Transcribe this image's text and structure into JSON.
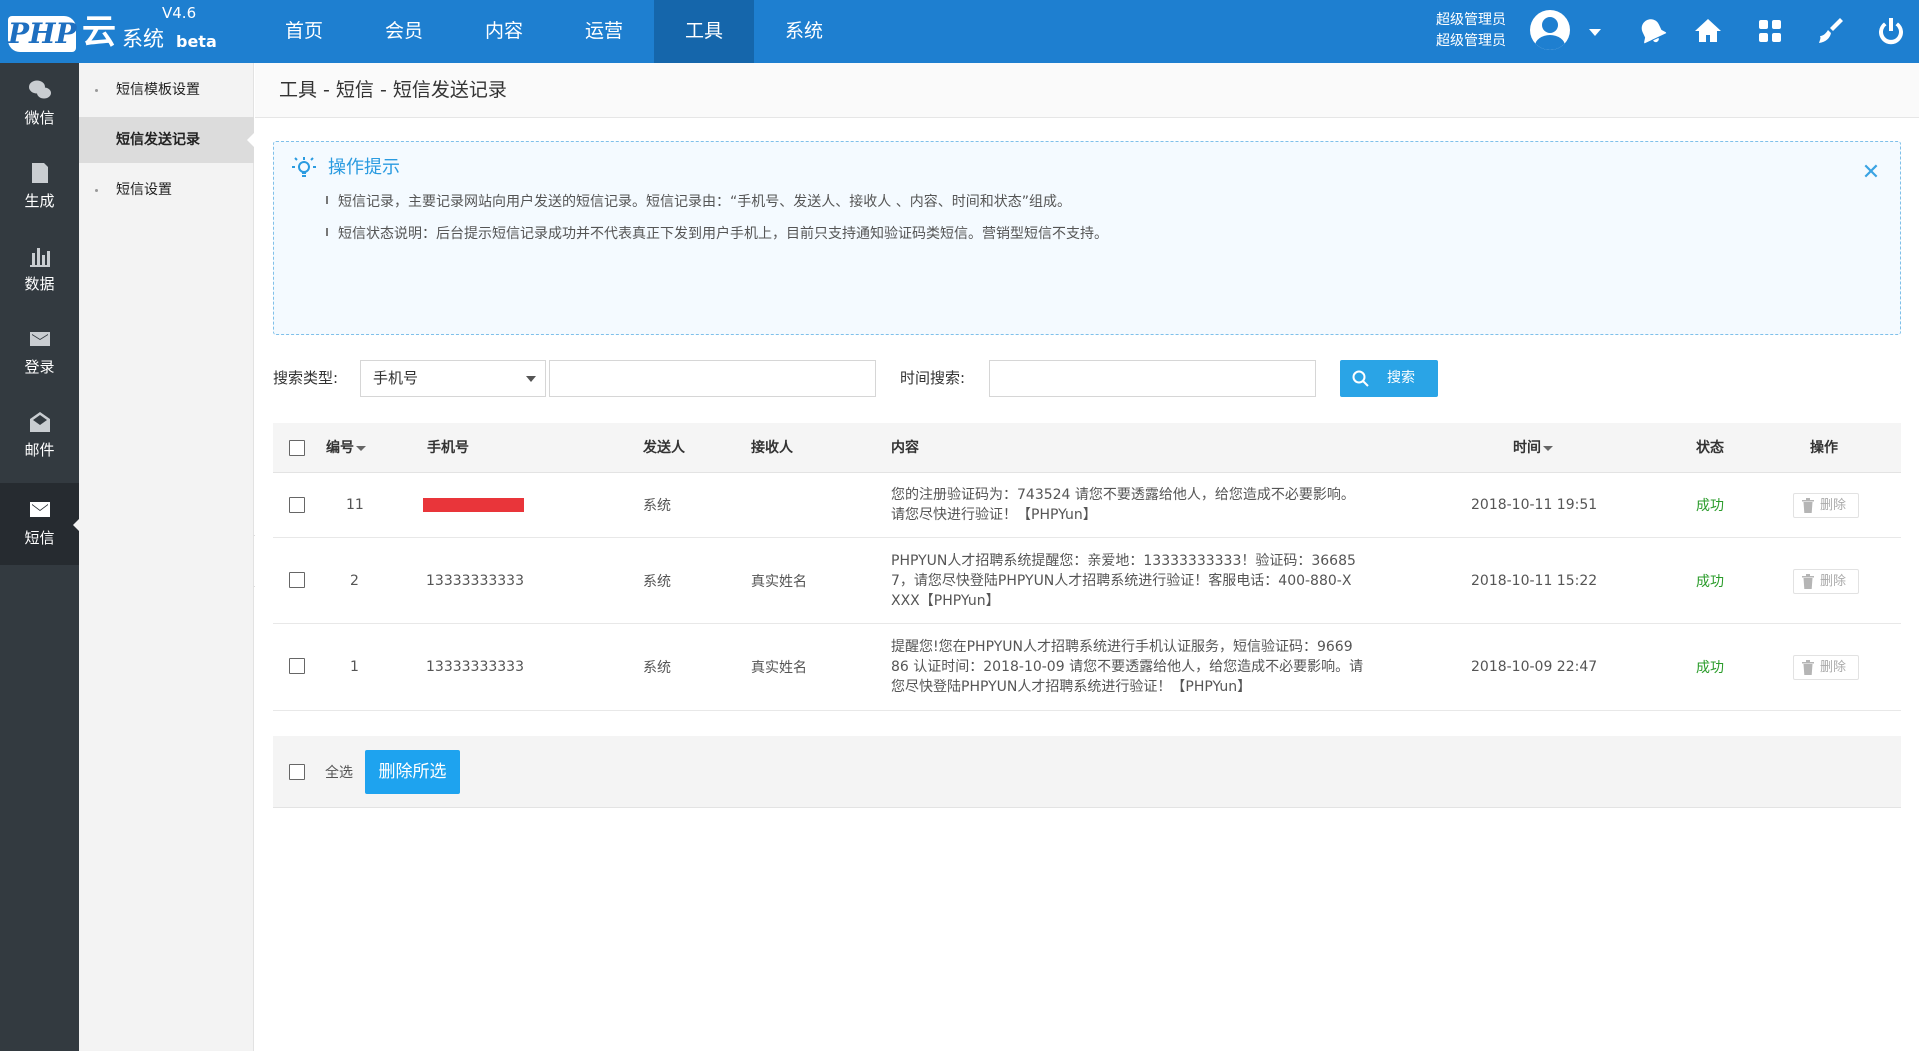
{
  "app": {
    "logo_mark": "PHP",
    "logo_cloud": "云",
    "logo_system": "系统",
    "logo_beta": "beta",
    "version": "V4.6"
  },
  "topnav": [
    {
      "label": "首页",
      "active": false
    },
    {
      "label": "会员",
      "active": false
    },
    {
      "label": "内容",
      "active": false
    },
    {
      "label": "运营",
      "active": false
    },
    {
      "label": "工具",
      "active": true
    },
    {
      "label": "系统",
      "active": false
    }
  ],
  "user": {
    "line1": "超级管理员",
    "line2": "超级管理员"
  },
  "top_icons": [
    "notification-bell-icon",
    "home-icon",
    "apps-grid-icon",
    "clear-cache-brush-icon",
    "power-icon"
  ],
  "iconbar": [
    {
      "label": "微信",
      "icon": "wechat-icon",
      "active": false
    },
    {
      "label": "生成",
      "icon": "generate-icon",
      "active": false
    },
    {
      "label": "数据",
      "icon": "bar-chart-icon",
      "active": false
    },
    {
      "label": "登录",
      "icon": "login-envelope-icon",
      "active": false
    },
    {
      "label": "邮件",
      "icon": "mail-icon",
      "active": false
    },
    {
      "label": "短信",
      "icon": "sms-icon",
      "active": true
    }
  ],
  "submenu": [
    {
      "label": "短信模板设置",
      "active": false
    },
    {
      "label": "短信发送记录",
      "active": true
    },
    {
      "label": "短信设置",
      "active": false
    }
  ],
  "breadcrumb": "工具 - 短信 - 短信发送记录",
  "tips": {
    "title": "操作提示",
    "lines": [
      "短信记录，主要记录网站向用户发送的短信记录。短信记录由：“手机号、发送人、接收人 、内容、时间和状态”组成。",
      "短信状态说明：后台提示短信记录成功并不代表真正下发到用户手机上，目前只支持通知验证码类短信。营销型短信不支持。"
    ]
  },
  "search": {
    "type_label": "搜索类型:",
    "type_value": "手机号",
    "keyword_value": "",
    "time_label": "时间搜索:",
    "time_value": "",
    "button": "搜索"
  },
  "table": {
    "headers": {
      "id": "编号",
      "phone": "手机号",
      "sender": "发送人",
      "receiver": "接收人",
      "content": "内容",
      "time": "时间",
      "status": "状态",
      "action": "操作"
    },
    "rows": [
      {
        "id": "11",
        "phone": "",
        "phone_redacted": true,
        "sender": "系统",
        "receiver": "",
        "content": [
          "您的注册验证码为：743524 请您不要透露给他人，给您造成不必要影响。",
          "请您尽快进行验证！【PHPYun】"
        ],
        "time": "2018-10-11 19:51",
        "status": "成功",
        "action": "删除"
      },
      {
        "id": "2",
        "phone": "13333333333",
        "phone_redacted": false,
        "sender": "系统",
        "receiver": "真实姓名",
        "content": [
          "PHPYUN人才招聘系统提醒您：亲爱地：13333333333！验证码：36685",
          "7，请您尽快登陆PHPYUN人才招聘系统进行验证！客服电话：400-880-X",
          "XXX【PHPYun】"
        ],
        "time": "2018-10-11 15:22",
        "status": "成功",
        "action": "删除"
      },
      {
        "id": "1",
        "phone": "13333333333",
        "phone_redacted": false,
        "sender": "系统",
        "receiver": "真实姓名",
        "content": [
          "提醒您!您在PHPYUN人才招聘系统进行手机认证服务，短信验证码：9669",
          "86 认证时间：2018-10-09 请您不要透露给他人，给您造成不必要影响。请",
          "您尽快登陆PHPYUN人才招聘系统进行验证！【PHPYun】"
        ],
        "time": "2018-10-09 22:47",
        "status": "成功",
        "action": "删除"
      }
    ],
    "footer": {
      "select_all": "全选",
      "delete_selected": "删除所选"
    }
  },
  "colors": {
    "topbar": "#1e7fd0",
    "topnav_active": "#1566ab",
    "sidebar": "#333a40",
    "accent": "#2aa4e6",
    "success": "#2b9c2b",
    "redaction": "#e9353a"
  }
}
